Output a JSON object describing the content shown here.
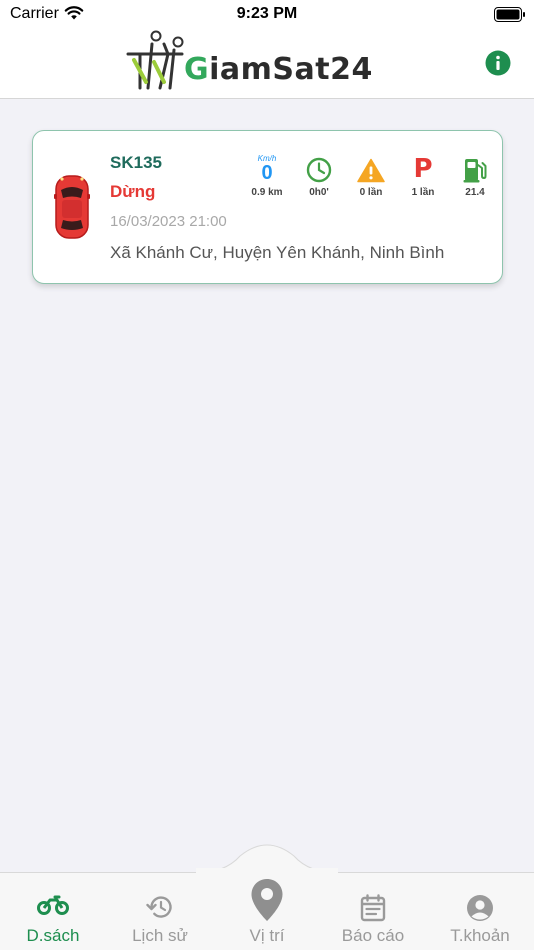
{
  "status_bar": {
    "carrier": "Carrier",
    "time": "9:23 PM"
  },
  "header": {
    "logo_text_accent": "G",
    "logo_text_rest": "iamSat24",
    "info_icon": "info-icon"
  },
  "vehicle": {
    "plate": "SK135",
    "status": "Dừng",
    "timestamp": "16/03/2023 21:00",
    "address": "Xã Khánh Cư, Huyện Yên Khánh, Ninh Bình",
    "speed_unit": "Km/h",
    "speed": "0",
    "distance": "0.9 km",
    "duration": "0h0'",
    "warnings": "0 lần",
    "parking": "1 lần",
    "parking_symbol": "P",
    "fuel": "21.4",
    "car_color": "#e53935"
  },
  "tabs": [
    {
      "label": "D.sách",
      "icon": "motorbike-icon",
      "active": true
    },
    {
      "label": "Lịch sử",
      "icon": "history-icon",
      "active": false
    },
    {
      "label": "Vị trí",
      "icon": "location-pin-icon",
      "active": false
    },
    {
      "label": "Báo cáo",
      "icon": "calendar-report-icon",
      "active": false
    },
    {
      "label": "T.khoản",
      "icon": "account-icon",
      "active": false
    }
  ],
  "colors": {
    "accent_green": "#1e8e4f",
    "plate_teal": "#1f6b5c",
    "status_red": "#e53935",
    "speed_blue": "#2196f3",
    "warning_orange": "#f5a623"
  }
}
